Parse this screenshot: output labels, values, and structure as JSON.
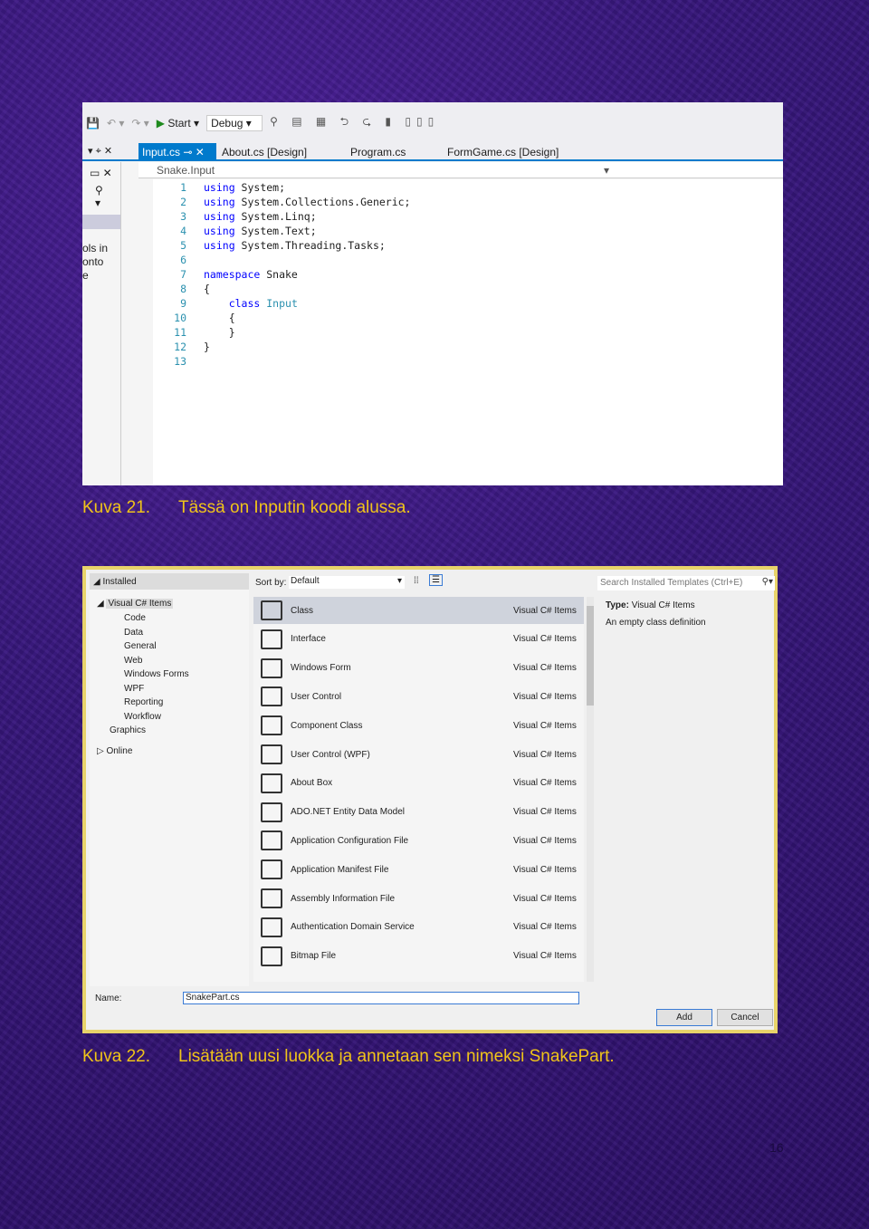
{
  "figure1": {
    "toolbar": {
      "start_label": "Start",
      "config": "Debug"
    },
    "tabs": [
      "Input.cs",
      "About.cs [Design]",
      "Program.cs",
      "FormGame.cs [Design]"
    ],
    "nav_dropdown": "Snake.Input",
    "left_pane_text": [
      "ols in",
      "onto",
      "e"
    ],
    "line_numbers": [
      "1",
      "2",
      "3",
      "4",
      "5",
      "6",
      "7",
      "8",
      "9",
      "10",
      "11",
      "12",
      "13"
    ],
    "code": [
      {
        "kw": "using",
        "rest": " System;"
      },
      {
        "kw": "using",
        "rest": " System.Collections.Generic;"
      },
      {
        "kw": "using",
        "rest": " System.Linq;"
      },
      {
        "kw": "using",
        "rest": " System.Text;"
      },
      {
        "kw": "using",
        "rest": " System.Threading.Tasks;"
      },
      {
        "kw": "",
        "rest": ""
      },
      {
        "kw": "namespace",
        "rest": " Snake"
      },
      {
        "kw": "",
        "rest": "{"
      },
      {
        "kw": "    class",
        "rest": " ",
        "ty": "Input"
      },
      {
        "kw": "",
        "rest": "    {"
      },
      {
        "kw": "",
        "rest": "    }"
      },
      {
        "kw": "",
        "rest": "}"
      },
      {
        "kw": "",
        "rest": ""
      }
    ]
  },
  "caption1": {
    "number": "Kuva 21.",
    "text": "Tässä on Inputin koodi alussa."
  },
  "figure2": {
    "tree": {
      "installed": "Installed",
      "visual_cs": "Visual C# Items",
      "children": [
        "Code",
        "Data",
        "General",
        "Web",
        "Windows Forms",
        "WPF",
        "Reporting",
        "Workflow"
      ],
      "graphics": "Graphics",
      "online": "Online"
    },
    "sort_label": "Sort by:",
    "sort_value": "Default",
    "search_placeholder": "Search Installed Templates (Ctrl+E)",
    "type_label": "Type:",
    "type_value": "Visual C# Items",
    "description": "An empty class definition",
    "items": [
      {
        "name": "Class",
        "type": "Visual C# Items"
      },
      {
        "name": "Interface",
        "type": "Visual C# Items"
      },
      {
        "name": "Windows Form",
        "type": "Visual C# Items"
      },
      {
        "name": "User Control",
        "type": "Visual C# Items"
      },
      {
        "name": "Component Class",
        "type": "Visual C# Items"
      },
      {
        "name": "User Control (WPF)",
        "type": "Visual C# Items"
      },
      {
        "name": "About Box",
        "type": "Visual C# Items"
      },
      {
        "name": "ADO.NET Entity Data Model",
        "type": "Visual C# Items"
      },
      {
        "name": "Application Configuration File",
        "type": "Visual C# Items"
      },
      {
        "name": "Application Manifest File",
        "type": "Visual C# Items"
      },
      {
        "name": "Assembly Information File",
        "type": "Visual C# Items"
      },
      {
        "name": "Authentication Domain Service",
        "type": "Visual C# Items"
      },
      {
        "name": "Bitmap File",
        "type": "Visual C# Items"
      }
    ],
    "name_label": "Name:",
    "name_value": "SnakePart.cs",
    "add_label": "Add",
    "cancel_label": "Cancel"
  },
  "caption2": {
    "number": "Kuva 22.",
    "text": "Lisätään uusi luokka ja annetaan sen nimeksi SnakePart."
  },
  "page_number": "16",
  "colors": {
    "caption": "#f0c419",
    "accent": "#007acc",
    "background": "#36177a"
  }
}
